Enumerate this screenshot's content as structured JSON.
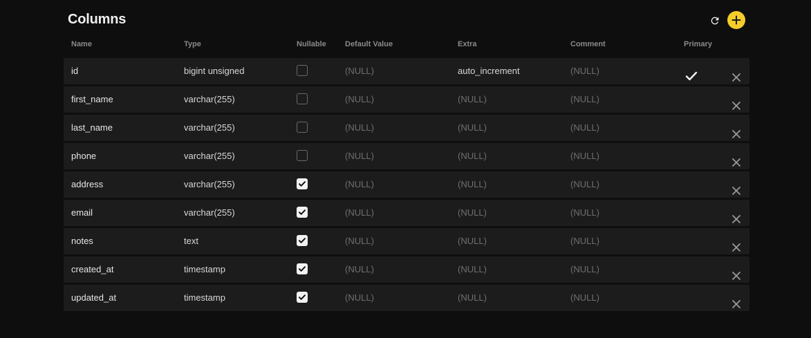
{
  "header": {
    "title": "Columns",
    "refresh_icon": "refresh-icon",
    "add_icon": "plus-icon",
    "accent_color": "#f5cd2a"
  },
  "columns": {
    "name": "Name",
    "type": "Type",
    "nullable": "Nullable",
    "default": "Default Value",
    "extra": "Extra",
    "comment": "Comment",
    "primary": "Primary"
  },
  "rows": [
    {
      "name": "id",
      "type": "bigint unsigned",
      "nullable": false,
      "default": "(NULL)",
      "extra": "auto_increment",
      "comment": "(NULL)",
      "primary": true
    },
    {
      "name": "first_name",
      "type": "varchar(255)",
      "nullable": false,
      "default": "(NULL)",
      "extra": "(NULL)",
      "comment": "(NULL)",
      "primary": false
    },
    {
      "name": "last_name",
      "type": "varchar(255)",
      "nullable": false,
      "default": "(NULL)",
      "extra": "(NULL)",
      "comment": "(NULL)",
      "primary": false
    },
    {
      "name": "phone",
      "type": "varchar(255)",
      "nullable": false,
      "default": "(NULL)",
      "extra": "(NULL)",
      "comment": "(NULL)",
      "primary": false
    },
    {
      "name": "address",
      "type": "varchar(255)",
      "nullable": true,
      "default": "(NULL)",
      "extra": "(NULL)",
      "comment": "(NULL)",
      "primary": false
    },
    {
      "name": "email",
      "type": "varchar(255)",
      "nullable": true,
      "default": "(NULL)",
      "extra": "(NULL)",
      "comment": "(NULL)",
      "primary": false
    },
    {
      "name": "notes",
      "type": "text",
      "nullable": true,
      "default": "(NULL)",
      "extra": "(NULL)",
      "comment": "(NULL)",
      "primary": false
    },
    {
      "name": "created_at",
      "type": "timestamp",
      "nullable": true,
      "default": "(NULL)",
      "extra": "(NULL)",
      "comment": "(NULL)",
      "primary": false
    },
    {
      "name": "updated_at",
      "type": "timestamp",
      "nullable": true,
      "default": "(NULL)",
      "extra": "(NULL)",
      "comment": "(NULL)",
      "primary": false
    }
  ]
}
